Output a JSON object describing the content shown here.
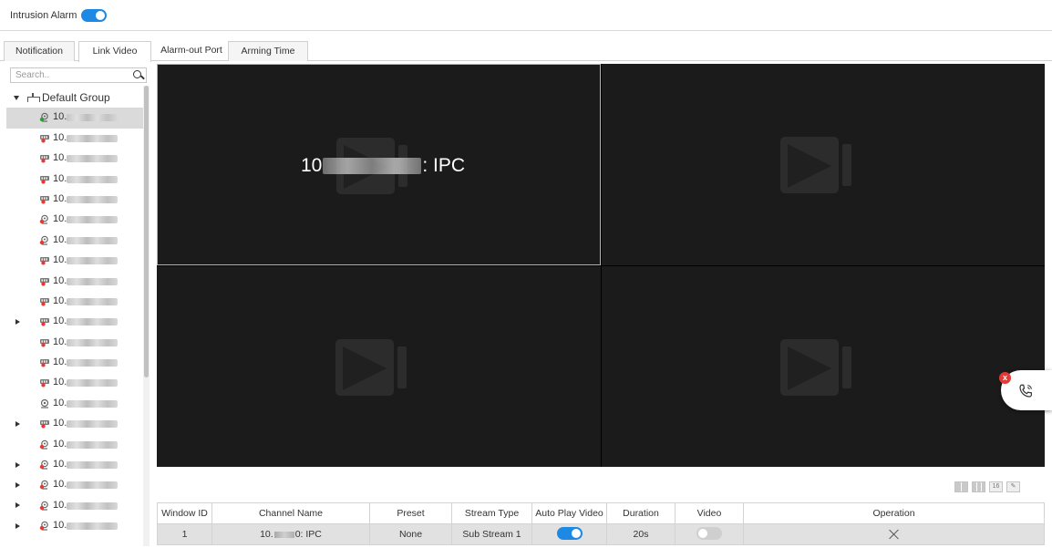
{
  "header": {
    "title": "Intrusion Alarm",
    "enabled": true
  },
  "tabs": [
    {
      "label": "Notification",
      "active": false
    },
    {
      "label": "Link Video",
      "active": true
    },
    {
      "label": "Alarm-out Port",
      "active": false
    },
    {
      "label": "Arming Time",
      "active": false
    }
  ],
  "search": {
    "placeholder": "Search.."
  },
  "tree": {
    "group": "Default Group",
    "ip_prefix": "10.",
    "devices": [
      {
        "ip": "10.",
        "icon": "camera-online-icon",
        "status": "online",
        "expandable": false,
        "selected": true
      },
      {
        "ip": "10.",
        "icon": "nvr-offline-icon",
        "status": "offline",
        "expandable": false
      },
      {
        "ip": "10.",
        "icon": "nvr-offline-icon",
        "status": "offline",
        "expandable": false
      },
      {
        "ip": "10.",
        "icon": "nvr-offline-icon",
        "status": "offline",
        "expandable": false
      },
      {
        "ip": "10.",
        "icon": "nvr-offline-icon",
        "status": "offline",
        "expandable": false
      },
      {
        "ip": "10.",
        "icon": "camera-offline-icon",
        "status": "offline",
        "expandable": false
      },
      {
        "ip": "10.",
        "icon": "camera-offline-icon",
        "status": "offline",
        "expandable": false
      },
      {
        "ip": "10.",
        "icon": "nvr-offline-icon",
        "status": "offline",
        "expandable": false
      },
      {
        "ip": "10.",
        "icon": "nvr-offline-icon",
        "status": "offline",
        "expandable": false
      },
      {
        "ip": "10.",
        "icon": "nvr-offline-icon",
        "status": "offline",
        "expandable": false
      },
      {
        "ip": "10.",
        "icon": "nvr-offline-icon",
        "status": "offline",
        "expandable": true
      },
      {
        "ip": "10.",
        "icon": "nvr-offline-icon",
        "status": "offline",
        "expandable": false
      },
      {
        "ip": "10.",
        "icon": "nvr-offline-icon",
        "status": "offline",
        "expandable": false
      },
      {
        "ip": "10.",
        "icon": "nvr-offline-icon",
        "status": "offline",
        "expandable": false
      },
      {
        "ip": "10.",
        "icon": "dome-camera-icon",
        "status": "offline",
        "expandable": false
      },
      {
        "ip": "10.",
        "icon": "nvr-offline-icon",
        "status": "offline",
        "expandable": true
      },
      {
        "ip": "10.",
        "icon": "camera-offline-icon",
        "status": "offline",
        "expandable": false
      },
      {
        "ip": "10.",
        "icon": "camera-offline-icon",
        "status": "offline",
        "expandable": true
      },
      {
        "ip": "10.",
        "icon": "camera-offline-icon",
        "status": "offline",
        "expandable": true
      },
      {
        "ip": "10.",
        "icon": "camera-offline-icon",
        "status": "offline",
        "expandable": true
      },
      {
        "ip": "10.",
        "icon": "camera-offline-icon",
        "status": "offline",
        "expandable": true
      }
    ]
  },
  "video": {
    "overlay_prefix": "10",
    "overlay_suffix": ": IPC"
  },
  "table": {
    "headers": [
      "Window ID",
      "Channel Name",
      "Preset",
      "Stream Type",
      "Auto Play Video",
      "Duration",
      "Video",
      "Operation"
    ],
    "rows": [
      {
        "window_id": "1",
        "channel_prefix": "10.",
        "channel_suffix": "0: IPC",
        "preset": "None",
        "stream_type": "Sub Stream 1",
        "auto_play": true,
        "duration": "20s",
        "video": false
      }
    ]
  },
  "layout_buttons": [
    "layout-4-icon",
    "layout-9-icon",
    "16",
    "edit-icon"
  ],
  "call": {
    "badge": "x"
  },
  "colors": {
    "accent": "#1e88e5",
    "video_bg": "#000000",
    "pane_bg": "#1b1b1b",
    "alert": "#e53935"
  }
}
